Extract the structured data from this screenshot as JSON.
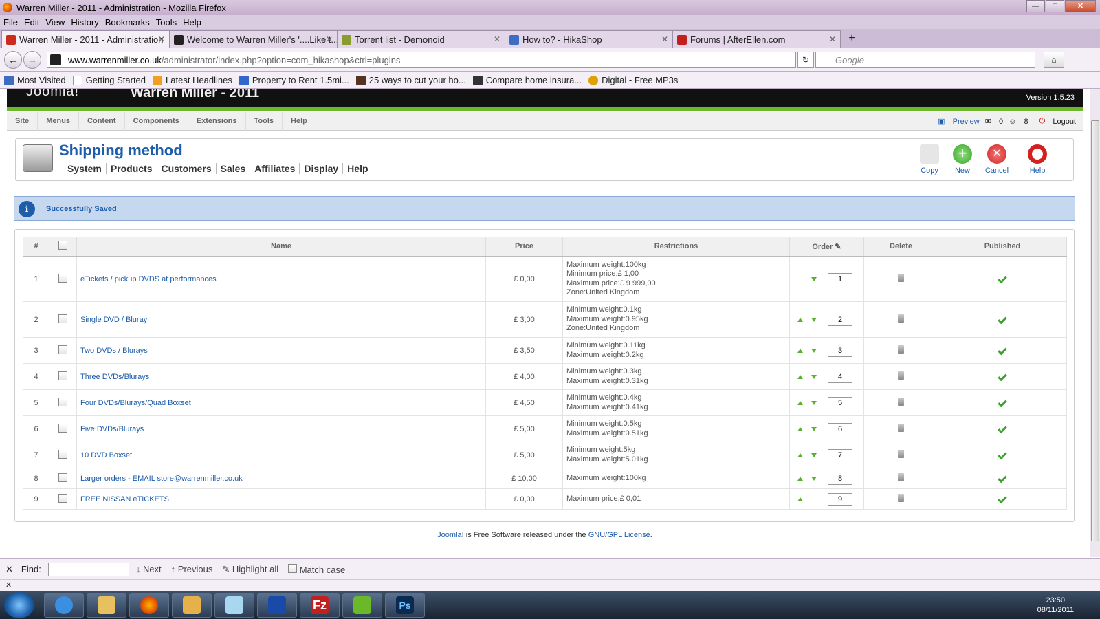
{
  "window": {
    "title": "Warren Miller - 2011 - Administration - Mozilla Firefox"
  },
  "menubar": [
    "File",
    "Edit",
    "View",
    "History",
    "Bookmarks",
    "Tools",
    "Help"
  ],
  "tabs": [
    {
      "label": "Warren Miller - 2011 - Administration",
      "color": "#cc2b1d"
    },
    {
      "label": "Welcome to Warren Miller's '....Like t...",
      "color": "#222222"
    },
    {
      "label": "Torrent list - Demonoid",
      "color": "#8a9c30"
    },
    {
      "label": "How to? - HikaShop",
      "color": "#3d6cc1"
    },
    {
      "label": "Forums | AfterEllen.com",
      "color": "#c21f1f"
    }
  ],
  "url": {
    "domain": "www.warrenmiller.co.uk",
    "path": "/administrator/index.php?option=com_hikashop&ctrl=plugins"
  },
  "search": {
    "placeholder": "Google"
  },
  "bookmarks": [
    {
      "label": "Most Visited",
      "color": "#3d6cc1"
    },
    {
      "label": "Getting Started",
      "color": "#ffffff"
    },
    {
      "label": "Latest Headlines",
      "color": "#f0a020"
    },
    {
      "label": "Property to Rent 1.5mi...",
      "color": "#3366cc"
    },
    {
      "label": "25 ways to cut your ho...",
      "color": "#553322"
    },
    {
      "label": "Compare home insura...",
      "color": "#333333"
    },
    {
      "label": "Digital - Free MP3s",
      "color": "#e0a000"
    }
  ],
  "joomla": {
    "logo": "Joomla!",
    "site": "Warren Miller - 2011",
    "version": "Version 1.5.23",
    "menu": [
      "Site",
      "Menus",
      "Content",
      "Components",
      "Extensions",
      "Tools",
      "Help"
    ],
    "right": {
      "preview": "Preview",
      "count1": "0",
      "count2": "8",
      "logout": "Logout"
    }
  },
  "page": {
    "title": "Shipping method",
    "submenu": [
      "System",
      "Products",
      "Customers",
      "Sales",
      "Affiliates",
      "Display",
      "Help"
    ],
    "buttons": {
      "copy": "Copy",
      "new": "New",
      "cancel": "Cancel",
      "help": "Help"
    },
    "message": "Successfully Saved"
  },
  "table": {
    "headers": {
      "num": "#",
      "name": "Name",
      "price": "Price",
      "restrictions": "Restrictions",
      "order": "Order",
      "delete": "Delete",
      "published": "Published"
    },
    "rows": [
      {
        "num": "1",
        "name": "eTickets / pickup DVDS at performances",
        "price": "£ 0,00",
        "restrictions": [
          "Maximum weight:100kg",
          "Minimum price:£ 1,00",
          "Maximum price:£ 9 999,00",
          "Zone:United Kingdom"
        ],
        "order": "1",
        "up": false,
        "down": true
      },
      {
        "num": "2",
        "name": "Single DVD / Bluray",
        "price": "£ 3,00",
        "restrictions": [
          "Minimum weight:0.1kg",
          "Maximum weight:0.95kg",
          "Zone:United Kingdom"
        ],
        "order": "2",
        "up": true,
        "down": true
      },
      {
        "num": "3",
        "name": "Two DVDs / Blurays",
        "price": "£ 3,50",
        "restrictions": [
          "Minimum weight:0.11kg",
          "Maximum weight:0.2kg"
        ],
        "order": "3",
        "up": true,
        "down": true
      },
      {
        "num": "4",
        "name": "Three DVDs/Blurays",
        "price": "£ 4,00",
        "restrictions": [
          "Minimum weight:0.3kg",
          "Maximum weight:0.31kg"
        ],
        "order": "4",
        "up": true,
        "down": true
      },
      {
        "num": "5",
        "name": "Four DVDs/Blurays/Quad Boxset",
        "price": "£ 4,50",
        "restrictions": [
          "Minimum weight:0.4kg",
          "Maximum weight:0.41kg"
        ],
        "order": "5",
        "up": true,
        "down": true
      },
      {
        "num": "6",
        "name": "Five DVDs/Blurays",
        "price": "£ 5,00",
        "restrictions": [
          "Minimum weight:0.5kg",
          "Maximum weight:0.51kg"
        ],
        "order": "6",
        "up": true,
        "down": true
      },
      {
        "num": "7",
        "name": "10 DVD Boxset",
        "price": "£ 5,00",
        "restrictions": [
          "Minimum weight:5kg",
          "Maximum weight:5.01kg"
        ],
        "order": "7",
        "up": true,
        "down": true
      },
      {
        "num": "8",
        "name": "Larger orders - EMAIL store@warrenmiller.co.uk",
        "price": "£ 10,00",
        "restrictions": [
          "Maximum weight:100kg"
        ],
        "order": "8",
        "up": true,
        "down": true
      },
      {
        "num": "9",
        "name": "FREE NISSAN eTICKETS",
        "price": "£ 0,00",
        "restrictions": [
          "Maximum price:£ 0,01"
        ],
        "order": "9",
        "up": true,
        "down": false
      }
    ]
  },
  "footer": {
    "link1": "Joomla!",
    "middle": " is Free Software released under the ",
    "link2": "GNU/GPL License",
    "end": "."
  },
  "findbar": {
    "label": "Find:",
    "next": "Next",
    "previous": "Previous",
    "highlight": "Highlight all",
    "match": "Match case"
  },
  "taskbar": {
    "time": "23:50",
    "date": "08/11/2011",
    "apps": [
      "ie-icon",
      "explorer-icon",
      "firefox-icon",
      "outlook-icon",
      "notepad-icon",
      "app-icon",
      "filezilla-icon",
      "editor-icon",
      "photoshop-icon"
    ]
  }
}
